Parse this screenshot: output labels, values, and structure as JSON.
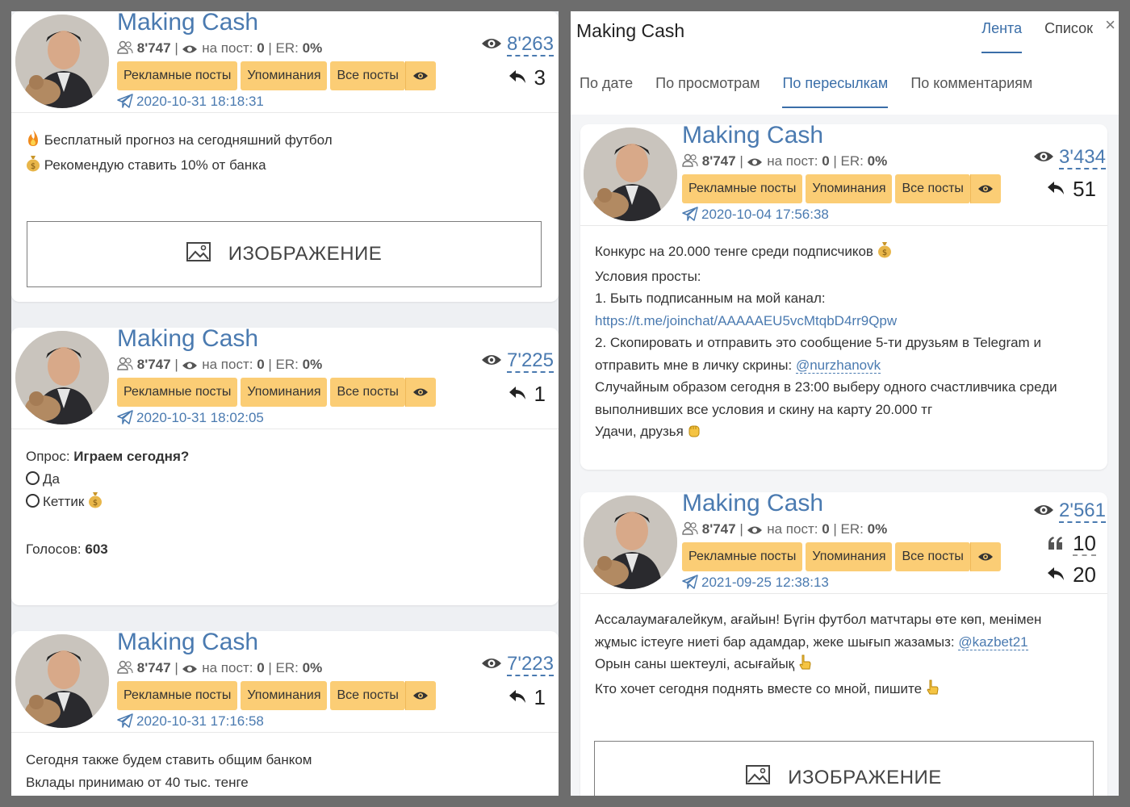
{
  "channel": {
    "name": "Making Cash",
    "subscribers": "8'747",
    "per_post_label": "на пост:",
    "per_post": "0",
    "er_label": "ER:",
    "er": "0%"
  },
  "buttons": {
    "ads": "Рекламные посты",
    "mentions": "Упоминания",
    "all": "Все посты"
  },
  "image_label": "ИЗОБРАЖЕНИЕ",
  "left": {
    "posts": [
      {
        "date": "2020-10-31 18:18:31",
        "views": "8'263",
        "forwards": "3",
        "lines": [
          "Бесплатный прогноз на сегодняшний футбол",
          "Рекомендую ставить 10% от банка"
        ]
      },
      {
        "date": "2020-10-31 18:02:05",
        "views": "7'225",
        "forwards": "1",
        "poll_label": "Опрос:",
        "poll_question": "Играем сегодня?",
        "options": [
          "Да",
          "Кеттик"
        ],
        "votes_label": "Голосов:",
        "votes": "603"
      },
      {
        "date": "2020-10-31 17:16:58",
        "views": "7'223",
        "forwards": "1",
        "lines": [
          "Сегодня также будем ставить общим банком",
          "Вклады принимаю от 40 тыс. тенге"
        ]
      }
    ]
  },
  "right": {
    "title": "Making Cash",
    "tabs": [
      "Лента",
      "Список"
    ],
    "close": "×",
    "sorts": [
      "По дате",
      "По просмотрам",
      "По пересылкам",
      "По комментариям"
    ],
    "posts": [
      {
        "date": "2020-10-04 17:56:38",
        "views": "3'434",
        "forwards": "51",
        "lines": [
          "Конкурс на 20.000 тенге среди подписчиков",
          "Условия просты:",
          "1. Быть подписанным на мой канал:",
          "https://t.me/joinchat/AAAAAEU5vcMtqbD4rr9Qpw",
          "2. Скопировать и отправить это сообщение 5-ти друзьям в Telegram и",
          "отправить мне в личку скрины:",
          "@nurzhanovk",
          "Случайным образом сегодня в 23:00 выберу одного счастливчика среди",
          "выполнивших все условия и скину на карту 20.000 тг",
          "Удачи, друзья"
        ]
      },
      {
        "date": "2021-09-25 12:38:13",
        "views": "2'561",
        "quotes": "10",
        "forwards": "20",
        "lines": [
          "Ассалаумағалейкум, ағайын! Бүгін футбол матчтары өте көп, менімен",
          "жұмыс істеуге ниеті бар адамдар, жеке шығып жазамыз:",
          "@kazbet21",
          "Орын саны шектеулі, асығайық",
          "Кто хочет сегодня поднять вместе со мной, пишите"
        ]
      }
    ]
  },
  "colors": {
    "accent": "#4a7ab0",
    "button": "#fbcd75",
    "background": "#6d6d6d"
  },
  "icons": [
    "eye-icon",
    "subscribers-icon",
    "telegram-plane-icon",
    "forward-arrow-icon",
    "quote-icon",
    "image-icon",
    "fire-emoji",
    "money-bag-emoji",
    "pointing-hand-emoji",
    "fist-emoji"
  ]
}
